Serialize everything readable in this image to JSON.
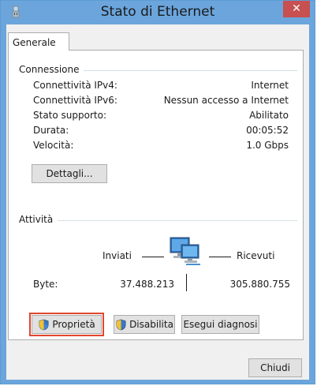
{
  "window": {
    "title": "Stato di Ethernet",
    "close_glyph": "✕"
  },
  "tabs": [
    {
      "label": "Generale"
    }
  ],
  "connection": {
    "group_label": "Connessione",
    "rows": [
      {
        "label": "Connettività IPv4:",
        "value": "Internet"
      },
      {
        "label": "Connettività IPv6:",
        "value": "Nessun accesso a Internet"
      },
      {
        "label": "Stato supporto:",
        "value": "Abilitato"
      },
      {
        "label": "Durata:",
        "value": "00:05:52"
      },
      {
        "label": "Velocità:",
        "value": "1.0 Gbps"
      }
    ],
    "details_button": "Dettagli..."
  },
  "activity": {
    "group_label": "Attività",
    "sent_label": "Inviati",
    "received_label": "Ricevuti",
    "bytes_label": "Byte:",
    "bytes_sent": "37.488.213",
    "bytes_received": "305.880.755",
    "icon": "network-computers-icon"
  },
  "buttons": {
    "properties": "Proprietà",
    "disable": "Disabilita",
    "diagnose": "Esegui diagnosi",
    "close": "Chiudi"
  },
  "colors": {
    "titlebar": "#6ba5dc",
    "close": "#c75050",
    "highlight": "#e0462e"
  }
}
